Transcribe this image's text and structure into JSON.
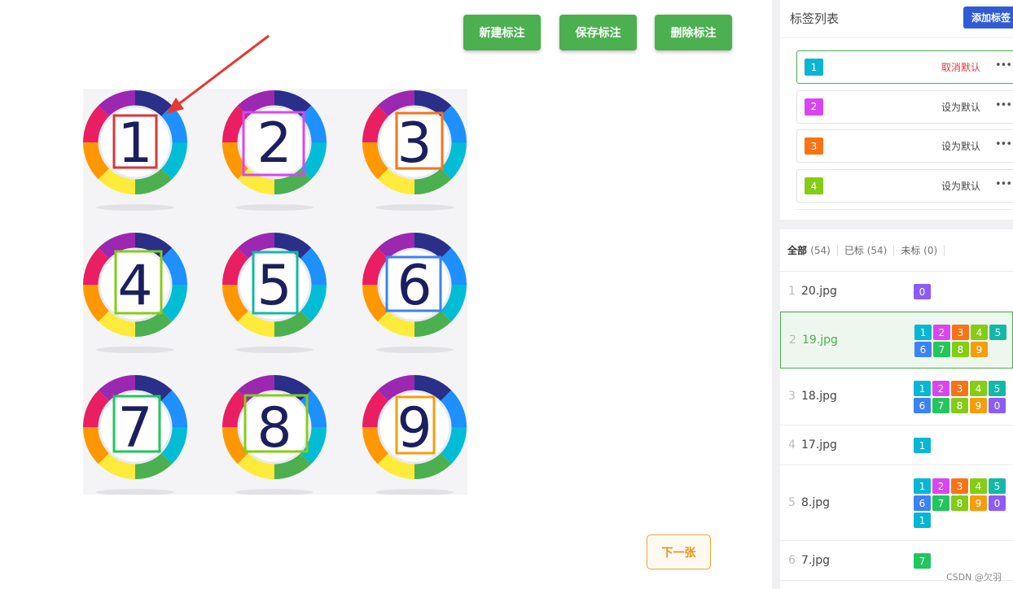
{
  "toolbar": {
    "new_label": "新建标注",
    "save_label": "保存标注",
    "delete_label": "删除标注"
  },
  "canvas": {
    "cells": [
      {
        "digit": "1",
        "box_color": "#d9373a"
      },
      {
        "digit": "2",
        "box_color": "#d946ef"
      },
      {
        "digit": "3",
        "box_color": "#f97316"
      },
      {
        "digit": "4",
        "box_color": "#84cc16"
      },
      {
        "digit": "5",
        "box_color": "#14b8a6"
      },
      {
        "digit": "6",
        "box_color": "#3b82f6"
      },
      {
        "digit": "7",
        "box_color": "#22c55e"
      },
      {
        "digit": "8",
        "box_color": "#84cc16"
      },
      {
        "digit": "9",
        "box_color": "#f59e0b"
      }
    ]
  },
  "next_button": "下一张",
  "tag_panel": {
    "title": "标签列表",
    "add_label": "添加标签",
    "tags": [
      {
        "name": "1",
        "color": "#06b6d4",
        "action": "取消默认",
        "is_default": true
      },
      {
        "name": "2",
        "color": "#d946ef",
        "action": "设为默认",
        "is_default": false
      },
      {
        "name": "3",
        "color": "#f97316",
        "action": "设为默认",
        "is_default": false
      },
      {
        "name": "4",
        "color": "#84cc16",
        "action": "设为默认",
        "is_default": false
      }
    ],
    "more_icon": "more-dots-icon"
  },
  "file_panel": {
    "filters": [
      {
        "label": "全部",
        "count": "(54)",
        "active": true
      },
      {
        "label": "已标",
        "count": "(54)",
        "active": false
      },
      {
        "label": "未标",
        "count": "(0)",
        "active": false
      }
    ],
    "files": [
      {
        "index": "1",
        "name": "20.jpg",
        "tags": [
          "0"
        ],
        "selected": false
      },
      {
        "index": "2",
        "name": "19.jpg",
        "tags": [
          "1",
          "2",
          "3",
          "4",
          "5",
          "6",
          "7",
          "8",
          "9"
        ],
        "selected": true
      },
      {
        "index": "3",
        "name": "18.jpg",
        "tags": [
          "1",
          "2",
          "3",
          "4",
          "5",
          "6",
          "7",
          "8",
          "9",
          "0"
        ],
        "selected": false
      },
      {
        "index": "4",
        "name": "17.jpg",
        "tags": [
          "1"
        ],
        "selected": false
      },
      {
        "index": "5",
        "name": "8.jpg",
        "tags": [
          "1",
          "2",
          "3",
          "4",
          "5",
          "6",
          "7",
          "8",
          "9",
          "0",
          "1"
        ],
        "selected": false
      },
      {
        "index": "6",
        "name": "7.jpg",
        "tags": [
          "7"
        ],
        "selected": false
      }
    ],
    "tag_colors": {
      "0": "#8b5cf6",
      "1": "#06b6d4",
      "2": "#d946ef",
      "3": "#f97316",
      "4": "#84cc16",
      "5": "#14b8a6",
      "6": "#3b82f6",
      "7": "#22c55e",
      "8": "#84cc16",
      "9": "#f59e0b"
    }
  },
  "watermark": "CSDN @欠羽",
  "colors": {
    "primary_button": "#4caf50",
    "add_button": "#2f5bd6",
    "arrow": "#e53935"
  }
}
